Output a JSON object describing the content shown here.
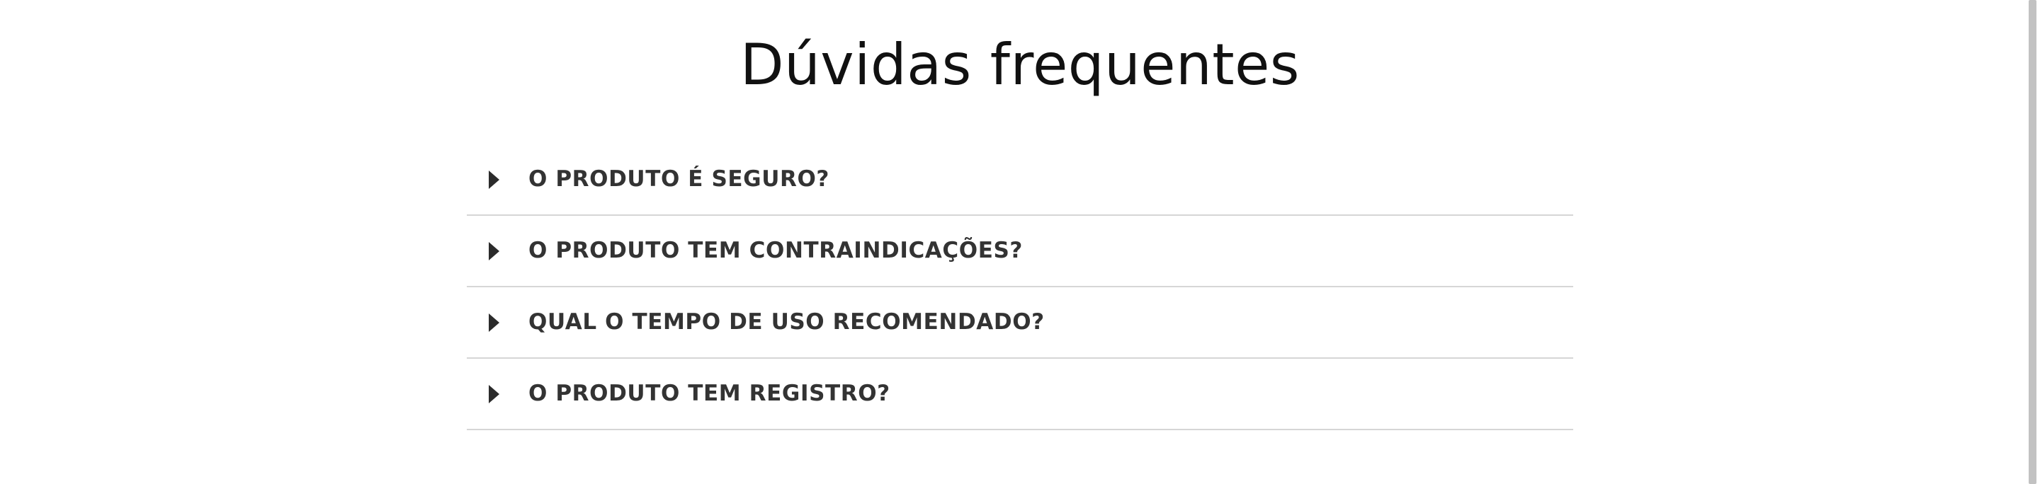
{
  "faq": {
    "title": "Dúvidas frequentes",
    "items": [
      {
        "question": "O PRODUTO É SEGURO?",
        "icon": "caret-right-icon"
      },
      {
        "question": "O PRODUTO TEM CONTRAINDICAÇÕES?",
        "icon": "caret-right-icon"
      },
      {
        "question": "QUAL O TEMPO DE USO RECOMENDADO?",
        "icon": "caret-right-icon"
      },
      {
        "question": "O PRODUTO TEM REGISTRO?",
        "icon": "caret-right-icon"
      }
    ]
  },
  "colors": {
    "title": "#111111",
    "question": "#333333",
    "divider": "#d6d6d6",
    "scrollbar": "#c2c2c2"
  }
}
